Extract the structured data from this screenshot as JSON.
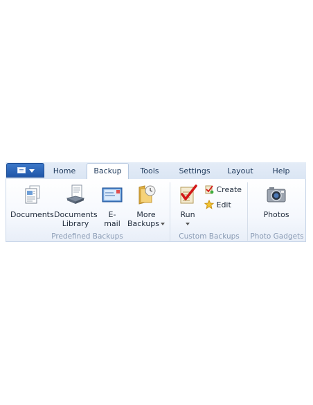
{
  "tabs": [
    "Home",
    "Backup",
    "Tools",
    "Settings",
    "Layout",
    "Help"
  ],
  "active_tab": "Backup",
  "groups": {
    "predefined": {
      "label": "Predefined Backups",
      "buttons": {
        "documents": [
          "Documents"
        ],
        "documents_library": [
          "Documents",
          "Library"
        ],
        "email": [
          "E-",
          "mail"
        ],
        "more_backups": [
          "More",
          "Backups"
        ]
      }
    },
    "custom": {
      "label": "Custom Backups",
      "run": "Run",
      "create": "Create",
      "edit": "Edit"
    },
    "gadgets": {
      "label": "Photo Gadgets",
      "photos": "Photos"
    }
  },
  "colors": {
    "accent": "#1f56a8",
    "label_gray": "#8a9bb4",
    "tab_text": "#1e395b"
  }
}
